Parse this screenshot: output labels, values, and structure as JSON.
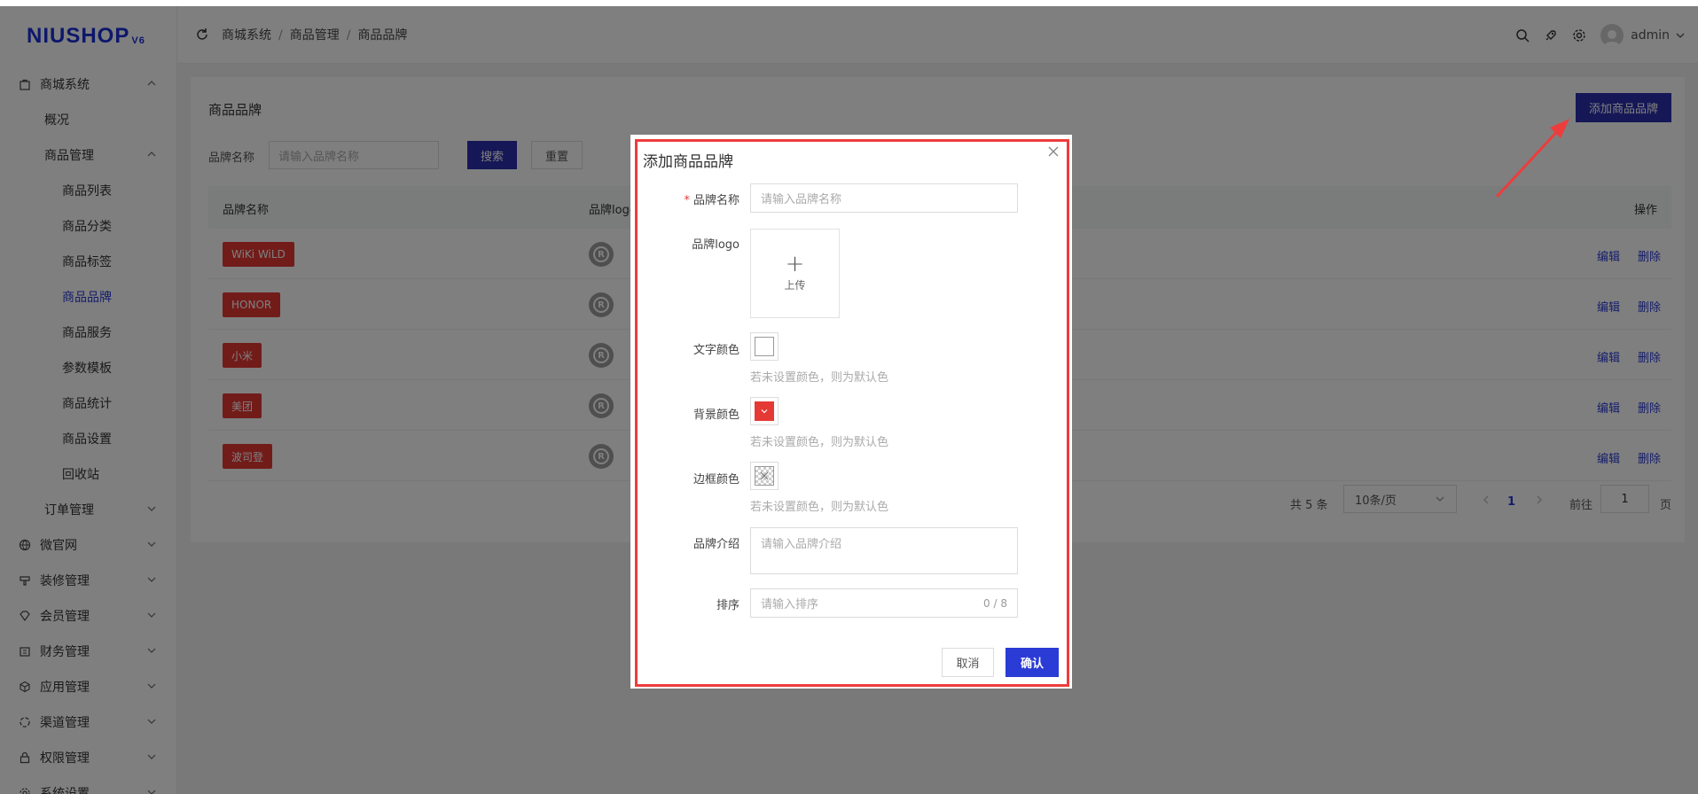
{
  "logo": {
    "main": "NIUSHOP",
    "version": "V6"
  },
  "sidebar": {
    "items": [
      {
        "label": "商城系统",
        "level": 0,
        "icon": "bag-icon",
        "expanded": true
      },
      {
        "label": "概况",
        "level": 1
      },
      {
        "label": "商品管理",
        "level": 1,
        "expanded": true
      },
      {
        "label": "商品列表",
        "level": 2
      },
      {
        "label": "商品分类",
        "level": 2
      },
      {
        "label": "商品标签",
        "level": 2
      },
      {
        "label": "商品品牌",
        "level": 2,
        "active": true
      },
      {
        "label": "商品服务",
        "level": 2
      },
      {
        "label": "参数模板",
        "level": 2
      },
      {
        "label": "商品统计",
        "level": 2
      },
      {
        "label": "商品设置",
        "level": 2
      },
      {
        "label": "回收站",
        "level": 2
      },
      {
        "label": "订单管理",
        "level": 1,
        "expanded": false
      },
      {
        "label": "微官网",
        "level": 0,
        "icon": "globe-icon",
        "expanded": false
      },
      {
        "label": "装修管理",
        "level": 0,
        "icon": "brush-icon",
        "expanded": false
      },
      {
        "label": "会员管理",
        "level": 0,
        "icon": "diamond-icon",
        "expanded": false
      },
      {
        "label": "财务管理",
        "level": 0,
        "icon": "wallet-icon",
        "expanded": false
      },
      {
        "label": "应用管理",
        "level": 0,
        "icon": "cube-icon",
        "expanded": false
      },
      {
        "label": "渠道管理",
        "level": 0,
        "icon": "channel-icon",
        "expanded": false
      },
      {
        "label": "权限管理",
        "level": 0,
        "icon": "lock-icon",
        "expanded": false
      },
      {
        "label": "系统设置",
        "level": 0,
        "icon": "gear-icon",
        "expanded": false
      }
    ]
  },
  "header": {
    "breadcrumb": [
      "商城系统",
      "商品管理",
      "商品品牌"
    ],
    "separator": "/",
    "user": "admin"
  },
  "page": {
    "title": "商品品牌",
    "add_button": "添加商品品牌",
    "filter": {
      "label": "品牌名称",
      "placeholder": "请输入品牌名称",
      "search": "搜索",
      "reset": "重置"
    },
    "table": {
      "columns": {
        "name": "品牌名称",
        "logo": "品牌logo",
        "action": "操作"
      },
      "rows": [
        {
          "name": "WiKi WiLD"
        },
        {
          "name": "HONOR"
        },
        {
          "name": "小米"
        },
        {
          "name": "美团"
        },
        {
          "name": "波司登"
        }
      ],
      "edit": "编辑",
      "delete": "删除"
    },
    "pagination": {
      "total": "共 5 条",
      "page_size": "10条/页",
      "current": "1",
      "goto": "前往",
      "goto_value": "1",
      "page_unit": "页"
    }
  },
  "dialog": {
    "title": "添加商品品牌",
    "fields": {
      "name": {
        "label": "品牌名称",
        "placeholder": "请输入品牌名称",
        "required": "*"
      },
      "logo": {
        "label": "品牌logo",
        "upload": "上传"
      },
      "text_color": {
        "label": "文字颜色",
        "hint": "若未设置颜色，则为默认色"
      },
      "bg_color": {
        "label": "背景颜色",
        "hint": "若未设置颜色，则为默认色",
        "value": "#e53935"
      },
      "border_color": {
        "label": "边框颜色",
        "hint": "若未设置颜色，则为默认色"
      },
      "intro": {
        "label": "品牌介绍",
        "placeholder": "请输入品牌介绍"
      },
      "sort": {
        "label": "排序",
        "placeholder": "请输入排序",
        "counter": "0 / 8"
      }
    },
    "cancel": "取消",
    "confirm": "确认"
  },
  "colors": {
    "accent": "#2b3bd6",
    "tag": "#e53935",
    "highlight": "#ee3c3c"
  }
}
